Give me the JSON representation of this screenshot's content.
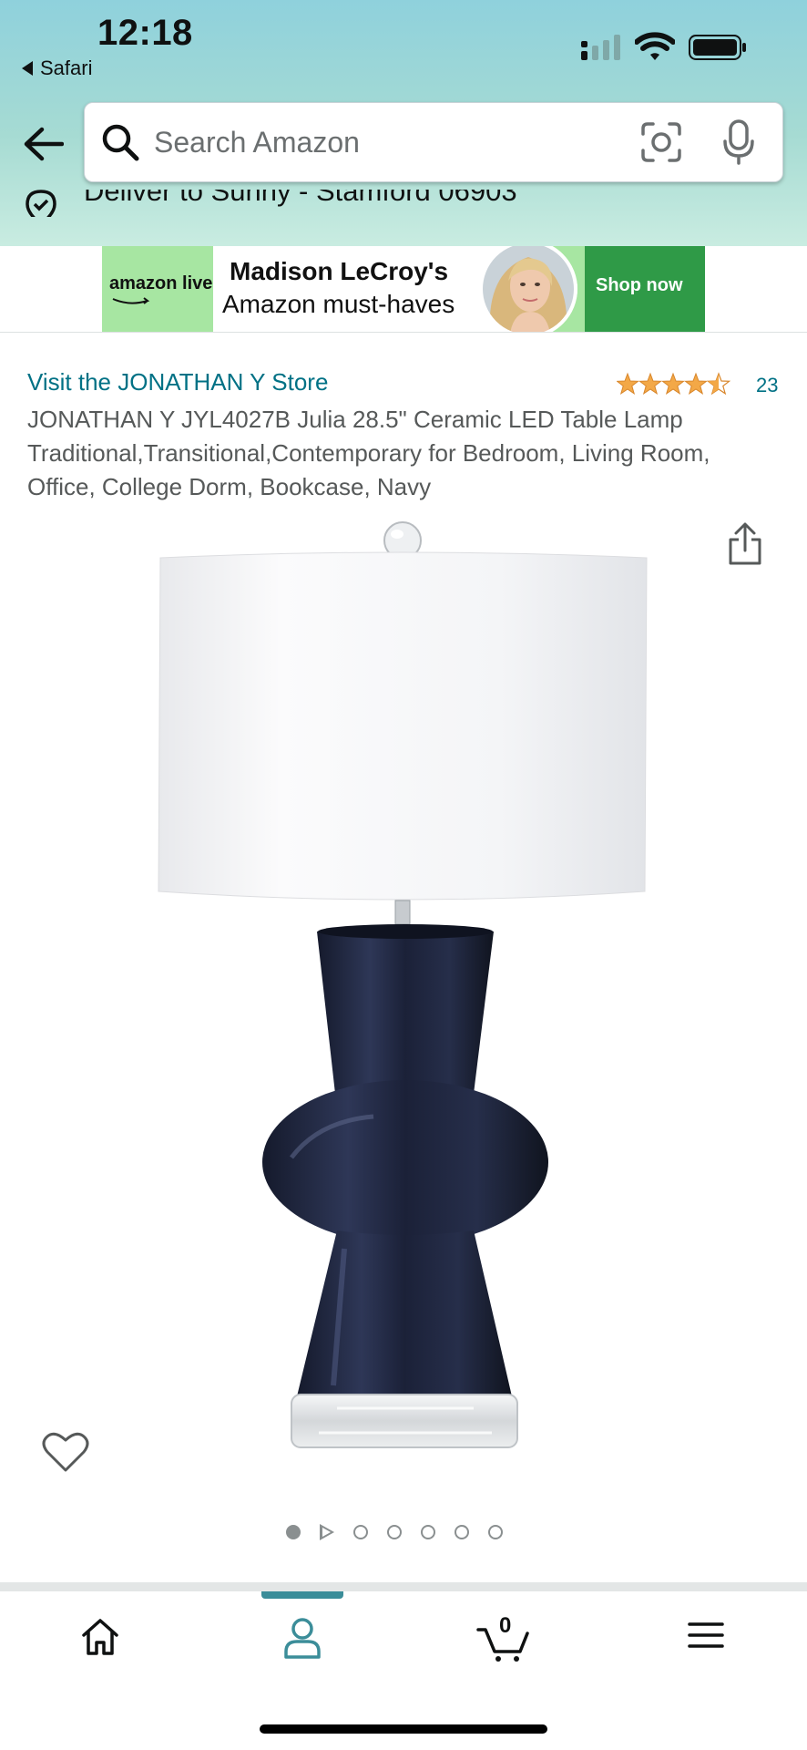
{
  "status_bar": {
    "time": "12:18",
    "back_app_label": "Safari"
  },
  "search": {
    "placeholder": "Search Amazon"
  },
  "delivery": {
    "text": "Deliver to Sunny - Stamford 06903"
  },
  "banner": {
    "logo_text": "amazon live",
    "title": "Madison LeCroy's",
    "subtitle": "Amazon must-haves",
    "cta": "Shop now"
  },
  "product": {
    "store_link": "Visit the JONATHAN Y Store",
    "rating_stars": 4.5,
    "rating_count": "23",
    "title": "JONATHAN Y JYL4027B Julia 28.5\" Ceramic LED Table Lamp Traditional,Transitional,Contemporary for Bedroom, Living Room, Office, College Dorm, Bookcase, Navy"
  },
  "gallery": {
    "active_index": 1,
    "total_items": 7
  },
  "bottom_nav": {
    "cart_count": "0",
    "active_tab": "account",
    "accent_color": "#3b8d99"
  },
  "colors": {
    "link": "#007185",
    "star": "#f3a847",
    "banner_green": "#2f9a47"
  }
}
